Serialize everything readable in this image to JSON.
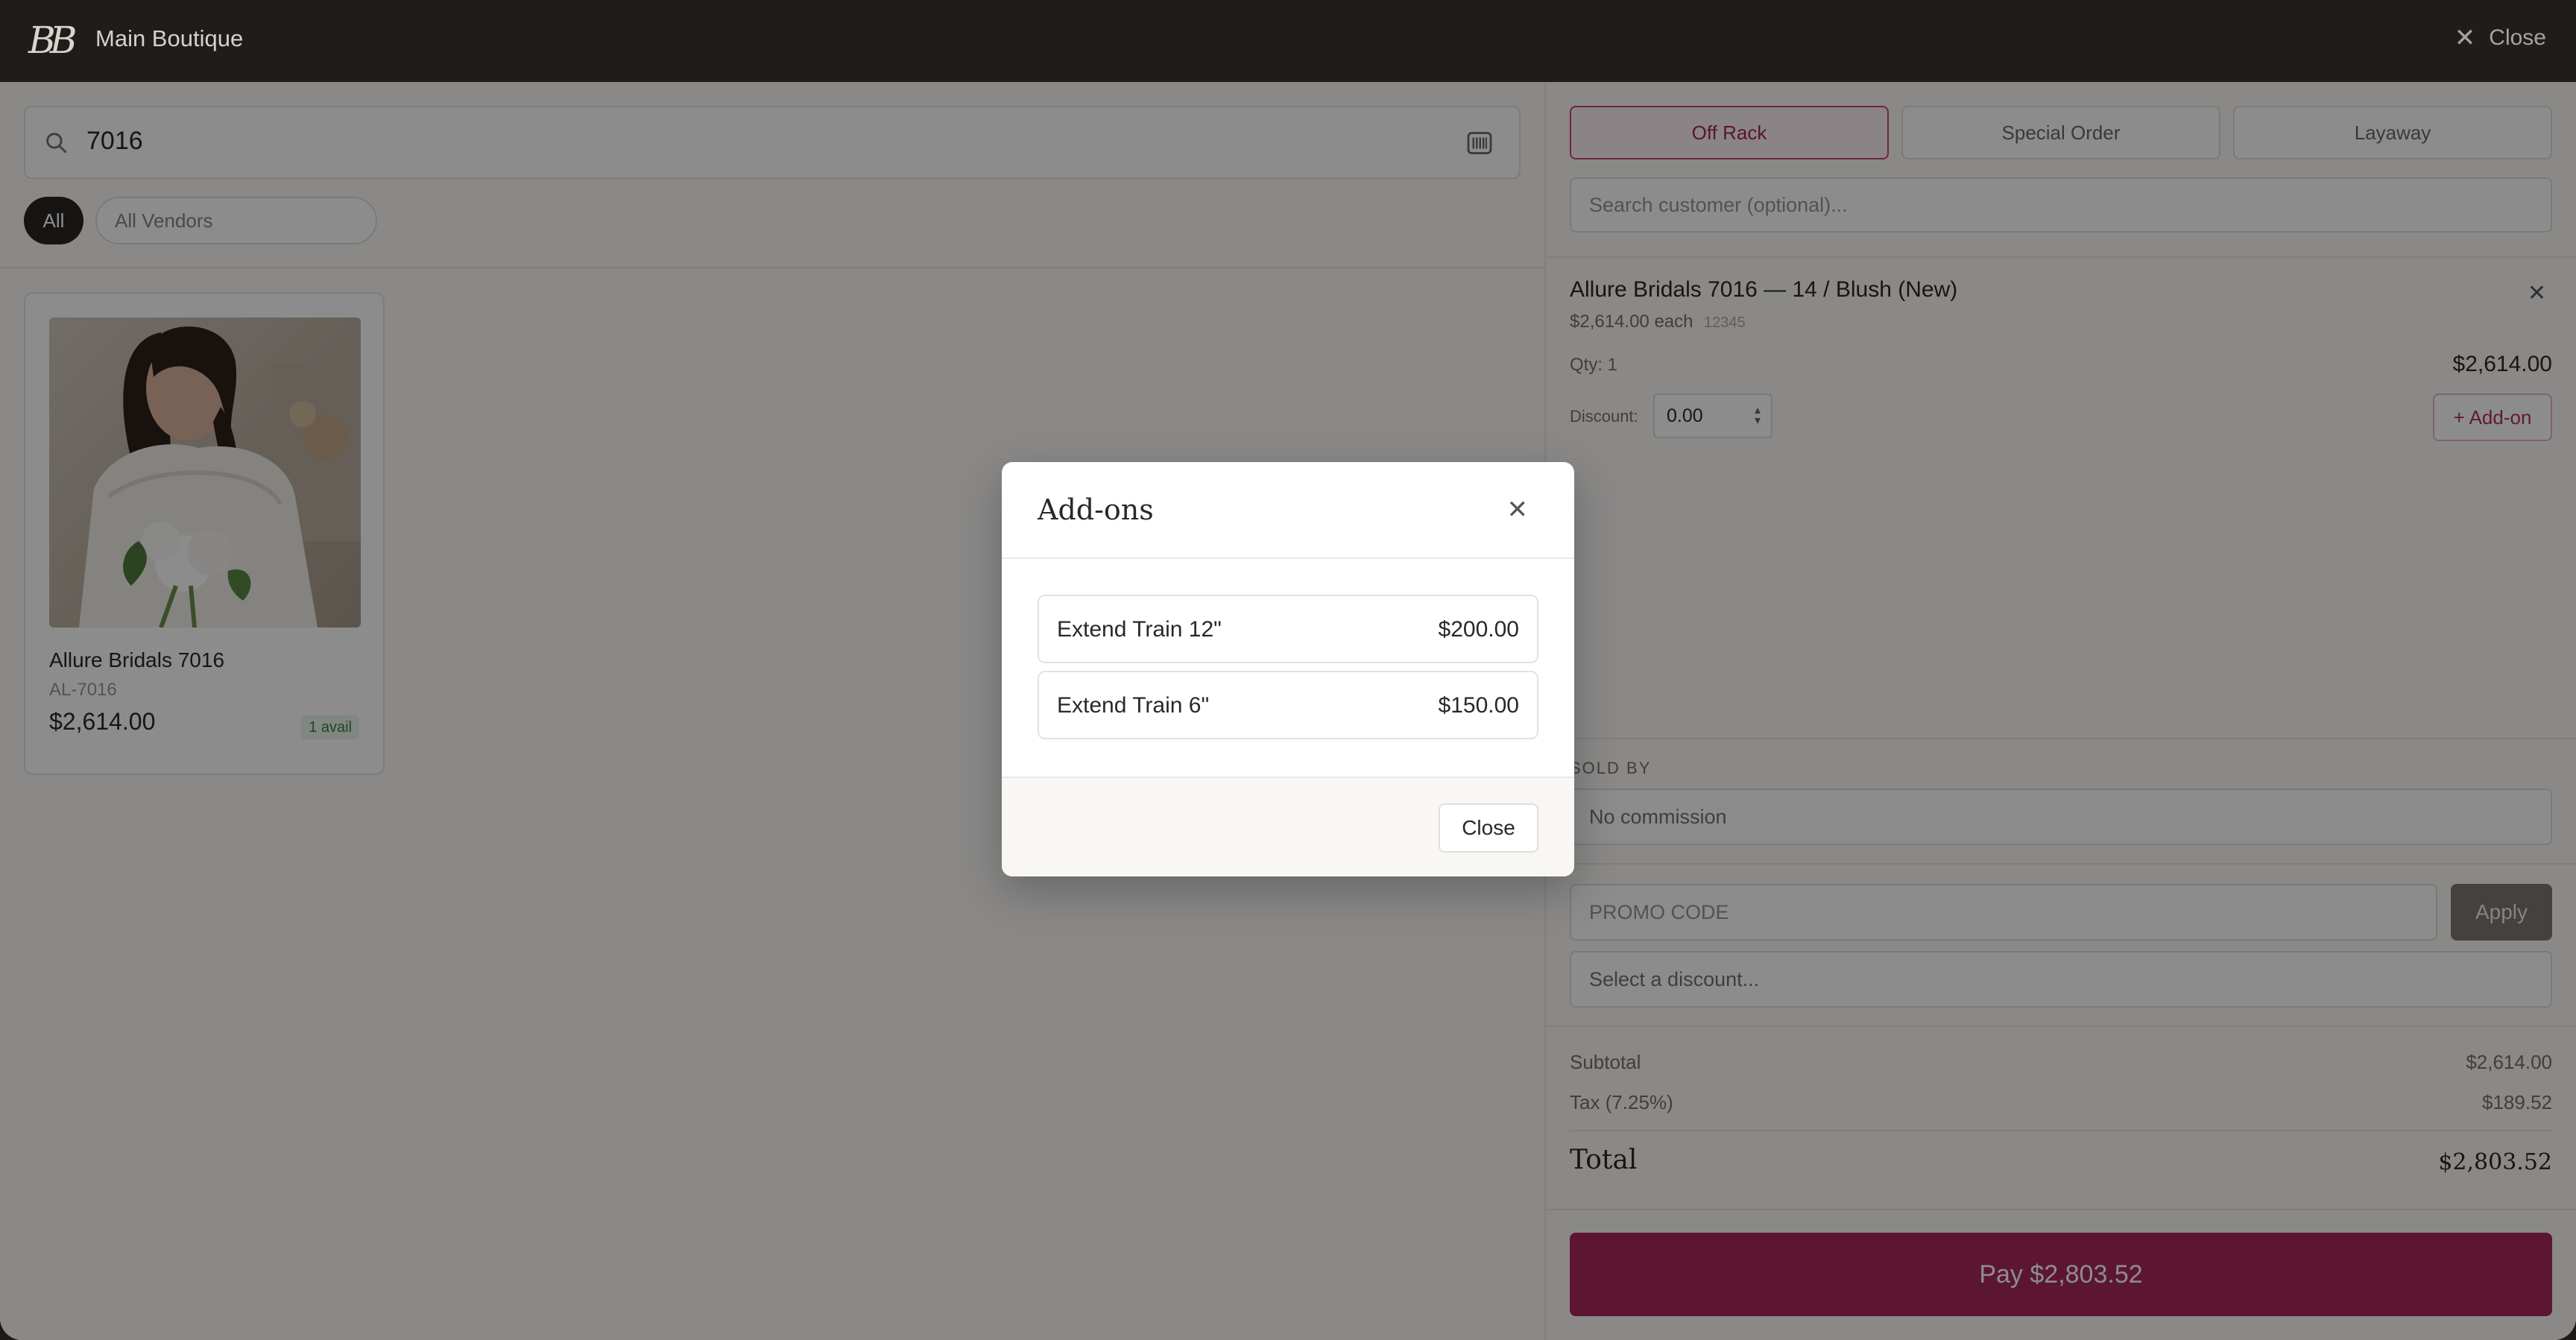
{
  "topbar": {
    "logo_text": "BB",
    "store_name": "Main Boutique",
    "close_label": "Close"
  },
  "search": {
    "value": "7016"
  },
  "filters": {
    "all_label": "All",
    "vendors_label": "All Vendors"
  },
  "product": {
    "name": "Allure Bridals 7016",
    "sku": "AL-7016",
    "price": "$2,614.00",
    "availability": "1 avail"
  },
  "sale_tabs": [
    {
      "label": "Off Rack",
      "active": true
    },
    {
      "label": "Special Order",
      "active": false
    },
    {
      "label": "Layaway",
      "active": false
    }
  ],
  "customer": {
    "placeholder": "Search customer (optional)..."
  },
  "line_item": {
    "title": "Allure Bridals 7016 — 14 / Blush (New)",
    "each": "$2,614.00 each",
    "code": "12345",
    "qty": "Qty: 1",
    "amount": "$2,614.00",
    "discount_label": "Discount:",
    "discount_value": "0.00",
    "addon_label": "+ Add-on"
  },
  "sold_by": {
    "label": "SOLD BY",
    "value": "No commission"
  },
  "promo": {
    "placeholder": "PROMO CODE",
    "apply_label": "Apply",
    "discount_placeholder": "Select a discount..."
  },
  "summary": {
    "subtotal_label": "Subtotal",
    "subtotal_value": "$2,614.00",
    "tax_label": "Tax (7.25%)",
    "tax_value": "$189.52",
    "total_label": "Total",
    "total_value": "$2,803.52"
  },
  "pay": {
    "label": "Pay $2,803.52"
  },
  "modal": {
    "title": "Add-ons",
    "items": [
      {
        "name": "Extend Train 12\"",
        "price": "$200.00"
      },
      {
        "name": "Extend Train 6\"",
        "price": "$150.00"
      }
    ],
    "close_label": "Close"
  }
}
